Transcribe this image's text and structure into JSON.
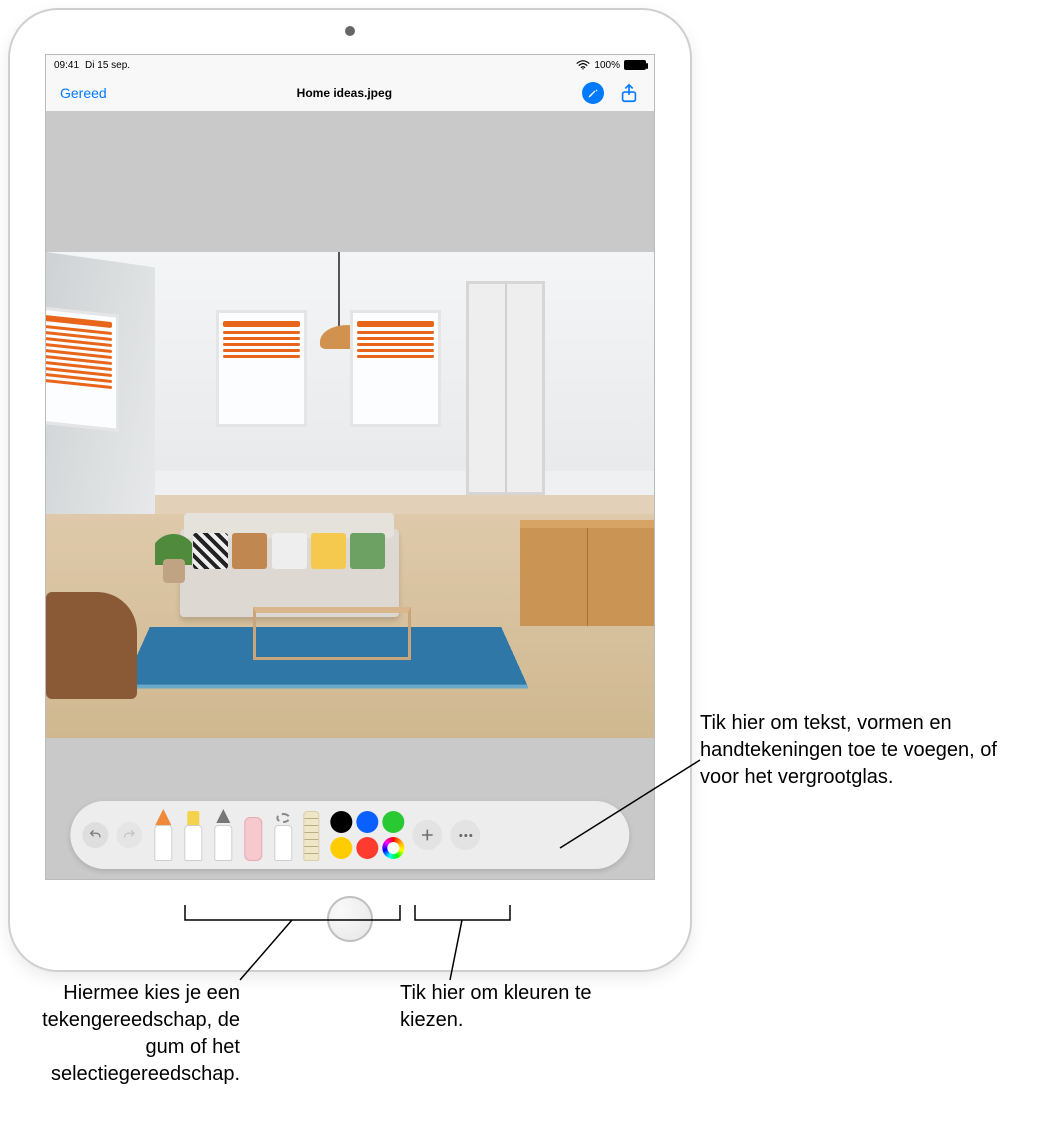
{
  "statusbar": {
    "time": "09:41",
    "date": "Di 15 sep.",
    "battery_pct": "100%"
  },
  "navbar": {
    "done_label": "Gereed",
    "title": "Home ideas.jpeg"
  },
  "toolbar": {
    "tools": [
      "pen",
      "marker",
      "pencil",
      "eraser",
      "lasso",
      "ruler"
    ],
    "colors": {
      "r1": [
        "#000000",
        "#0a60ff",
        "#29c933"
      ],
      "r2": [
        "#ffcc00",
        "#ff3b30",
        "multi"
      ]
    }
  },
  "callouts": {
    "add": "Tik hier om tekst, vormen en handtekeningen toe te voegen, of voor het vergrootglas.",
    "tools": "Hiermee kies je een tekengereedschap, de gum of het selectiegereedschap.",
    "colors": "Tik hier om kleuren te kiezen."
  }
}
